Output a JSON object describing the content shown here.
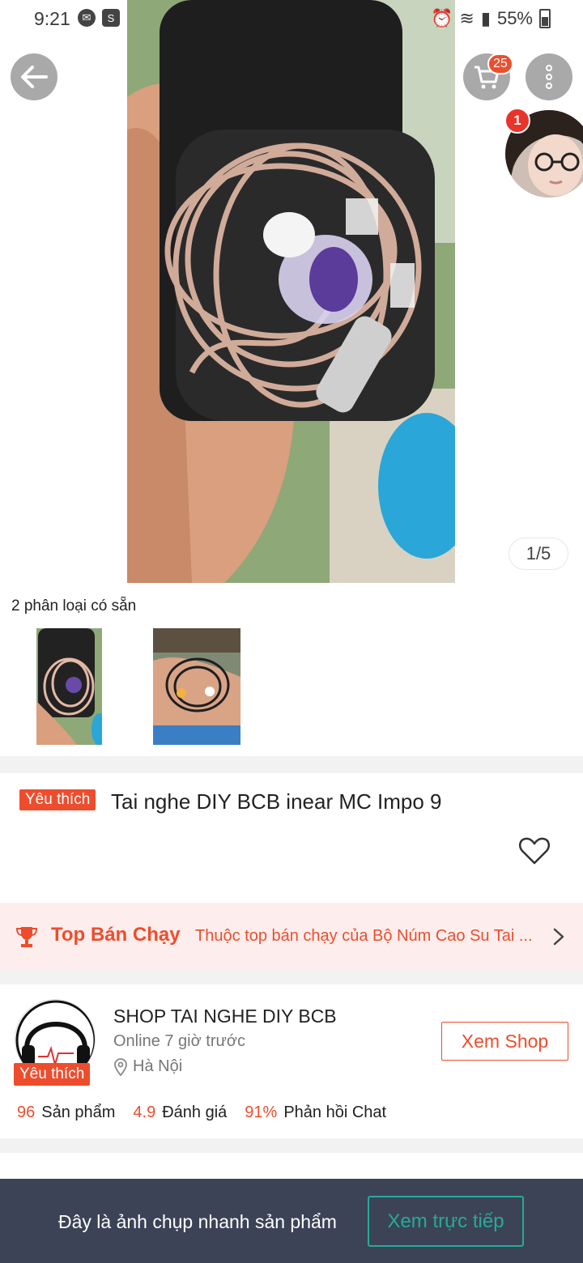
{
  "status_bar": {
    "time": "9:21",
    "battery": "55%"
  },
  "header": {
    "cart_count": "25",
    "live_badge": "1"
  },
  "gallery": {
    "counter": "1/5"
  },
  "variations": {
    "label": "2 phân loại có sẵn"
  },
  "product": {
    "favorite_tag": "Yêu thích",
    "title": "Tai nghe DIY BCB inear MC Impo 9"
  },
  "top_selling": {
    "title": "Top Bán Chạy",
    "description": "Thuộc top bán chạy của Bộ Núm Cao Su Tai ..."
  },
  "shop": {
    "name": "SHOP TAI NGHE DIY BCB",
    "online": "Online 7 giờ trước",
    "location": "Hà Nội",
    "favorite_tag": "Yêu thích",
    "view_button": "Xem Shop",
    "stats": [
      {
        "value": "96",
        "label": "Sản phẩm"
      },
      {
        "value": "4.9",
        "label": "Đánh giá"
      },
      {
        "value": "91%",
        "label": "Phản hồi Chat"
      }
    ]
  },
  "snapshot": {
    "text": "Đây là ảnh chụp nhanh sản phẩm",
    "button": "Xem trực tiếp"
  },
  "colors": {
    "accent": "#ee4d2d",
    "banner_bg": "#3c4357",
    "live_button": "#26aa99"
  }
}
